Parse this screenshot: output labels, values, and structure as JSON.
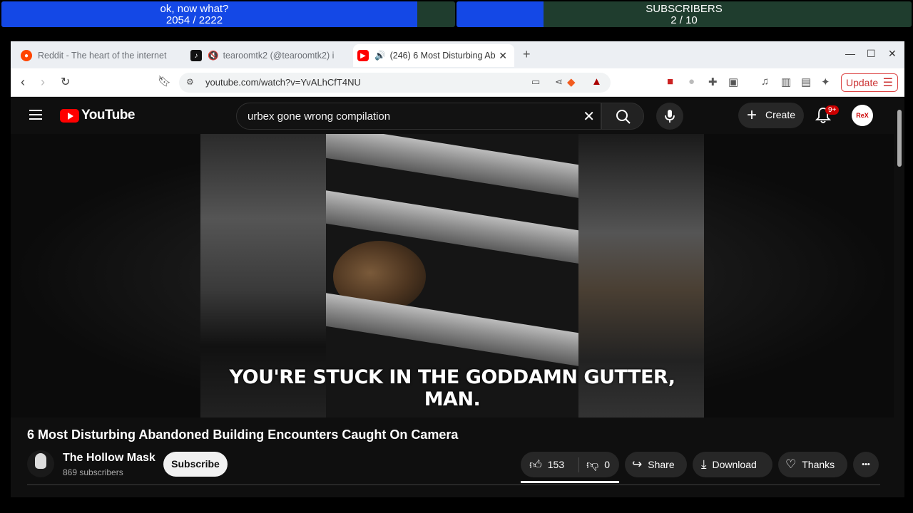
{
  "overlay": {
    "goal1": {
      "title": "ok, now what?",
      "count": "2054",
      "total": "2222",
      "progress": 0.924
    },
    "goal2": {
      "title": "SUBSCRIBERS",
      "count": "2",
      "total": "10",
      "progress": 0.2
    }
  },
  "browser": {
    "tabs": [
      {
        "title": "Reddit - The heart of the internet",
        "icon": "reddit-icon"
      },
      {
        "title": "tearoomtk2 (@tearoomtk2) i",
        "icon": "tiktok-icon"
      },
      {
        "title": "(246) 6 Most Disturbing Ab",
        "icon": "youtube-icon"
      }
    ],
    "url": "youtube.com/watch?v=YvALhCfT4NU",
    "update_label": "Update"
  },
  "youtube": {
    "logo": "YouTube",
    "search_query": "urbex gone wrong compilation",
    "create_label": "Create",
    "notification_badge": "9+",
    "subtitle": "YOU'RE STUCK IN THE GODDAMN GUTTER, MAN.",
    "video_title": "6 Most Disturbing Abandoned Building Encounters Caught On Camera",
    "channel_name": "The Hollow Mask",
    "subscribers": "869 subscribers",
    "subscribe_label": "Subscribe",
    "likes": "153",
    "dislikes": "0",
    "share_label": "Share",
    "download_label": "Download",
    "thanks_label": "Thanks",
    "more_label": "•••"
  }
}
